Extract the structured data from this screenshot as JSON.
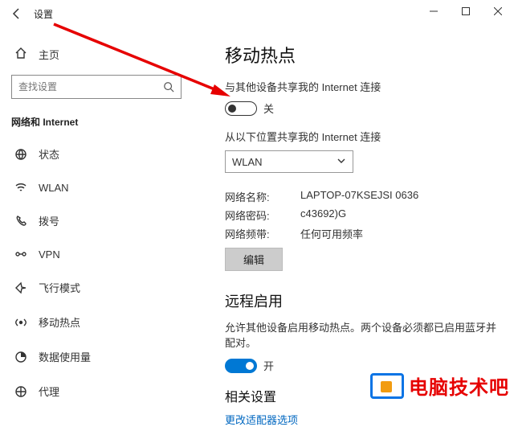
{
  "header": {
    "title": "设置"
  },
  "home_label": "主页",
  "search": {
    "placeholder": "查找设置"
  },
  "category": "网络和 Internet",
  "nav": {
    "status": "状态",
    "wlan": "WLAN",
    "dialup": "拨号",
    "vpn": "VPN",
    "airplane": "飞行模式",
    "hotspot": "移动热点",
    "datausage": "数据使用量",
    "proxy": "代理"
  },
  "main": {
    "title": "移动热点",
    "share_label": "与其他设备共享我的 Internet 连接",
    "share_state": "关",
    "from_label": "从以下位置共享我的 Internet 连接",
    "from_value": "WLAN",
    "net_name_k": "网络名称:",
    "net_name_v": "LAPTOP-07KSEJSI 0636",
    "net_pwd_k": "网络密码:",
    "net_pwd_v": "c43692)G",
    "net_band_k": "网络频带:",
    "net_band_v": "任何可用频率",
    "edit_label": "编辑",
    "remote_title": "远程启用",
    "remote_desc": "允许其他设备启用移动热点。两个设备必须都已启用蓝牙并配对。",
    "remote_state": "开",
    "related_title": "相关设置",
    "adapter_link": "更改适配器选项"
  },
  "watermark": {
    "text": "电脑技术吧"
  }
}
